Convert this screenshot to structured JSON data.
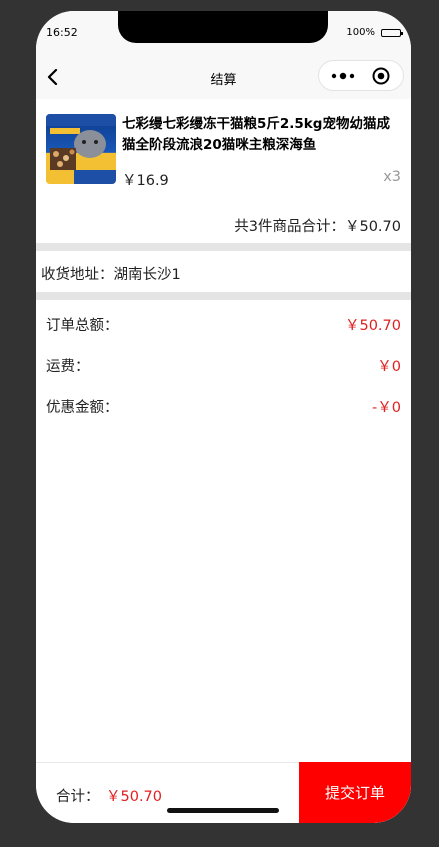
{
  "status_bar": {
    "time": "16:52",
    "battery": "100%",
    "battery_level": 1.0
  },
  "nav": {
    "title": "结算"
  },
  "product": {
    "title": "七彩缦七彩缦冻干猫粮5斤2.5kg宠物幼猫成猫全阶段流浪20猫咪主粮深海鱼",
    "price": "￥16.9",
    "quantity": "x3",
    "image_icon": "product-thumbnail"
  },
  "order_total": {
    "text": "共3件商品合计：￥50.70"
  },
  "address": {
    "text": "收货地址：湖南长沙1"
  },
  "summary": [
    {
      "label": "订单总额：",
      "value": "￥50.70"
    },
    {
      "label": "运费：",
      "value": "￥0"
    },
    {
      "label": "优惠金额：",
      "value": "-￥0"
    }
  ],
  "footer": {
    "total_label": "合计：",
    "total_value": "￥50.70",
    "submit_label": "提交订单"
  },
  "colors": {
    "accent": "#ff0000",
    "price": "#e02020",
    "divider": "#e5e5e5"
  }
}
